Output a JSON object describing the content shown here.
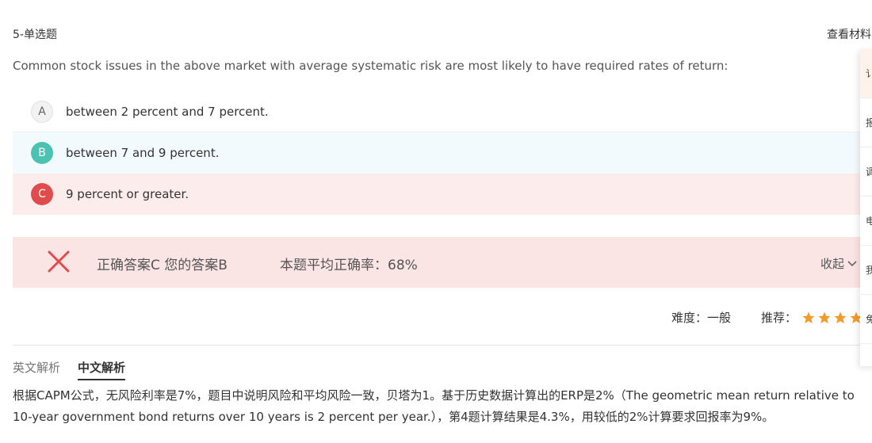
{
  "question": {
    "header": "5-单选题",
    "view_material": "查看材料",
    "text": "Common stock issues in the above market with average systematic risk are most likely to have required rates of return:"
  },
  "options": [
    {
      "letter": "A",
      "text": "between 2 percent and 7 percent."
    },
    {
      "letter": "B",
      "text": "between 7 and 9 percent."
    },
    {
      "letter": "C",
      "text": "9 percent or greater."
    }
  ],
  "result": {
    "answers": "正确答案C 您的答案B",
    "accuracy": "本题平均正确率：68%",
    "collapse_label": "收起",
    "status_icon": "close-icon",
    "status_color": "#e04c4c"
  },
  "meta": {
    "difficulty": "难度：一般",
    "recommend_label": "推荐：",
    "recommend_stars": 4,
    "star_color": "#f39a2b"
  },
  "tabs": [
    {
      "label": "英文解析",
      "active": false
    },
    {
      "label": "中文解析",
      "active": true
    }
  ],
  "analysis": {
    "text": "根据CAPM公式，无风险利率是7%，题目中说明风险和平均风险一致，贝塔为1。基于历史数据计算出的ERP是2%（The geometric mean return relative to 10-year government bond returns over 10 years is 2 percent per year.），第4题计算结果是4.3%，用较低的2%计算要求回报率为9%。"
  },
  "side_panel": {
    "items": [
      "讠",
      "报",
      "调",
      "电",
      "我",
      "免"
    ]
  }
}
